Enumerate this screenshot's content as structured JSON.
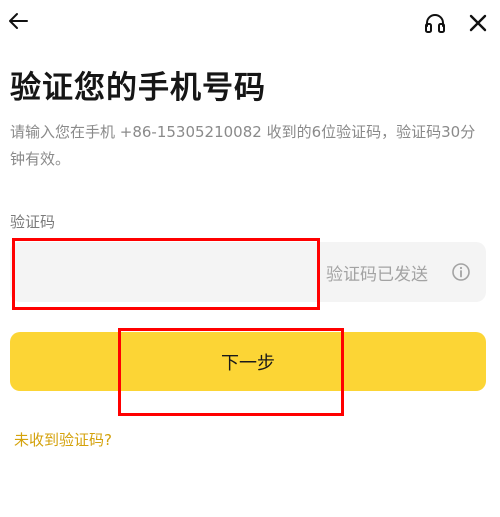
{
  "header": {
    "back_icon": "arrow-left-icon",
    "support_icon": "headset-icon",
    "close_icon": "close-icon"
  },
  "page": {
    "title": "验证您的手机号码",
    "description": "请输入您在手机 +86-15305210082 收到的6位验证码，验证码30分钟有效。"
  },
  "form": {
    "code_label": "验证码",
    "code_value": "",
    "code_status": "验证码已发送",
    "info_icon": "info-circle-icon",
    "submit_label": "下一步",
    "resend_link": "未收到验证码?"
  },
  "colors": {
    "accent": "#fcd535",
    "link": "#d4a20c",
    "highlight": "#ff0000"
  }
}
